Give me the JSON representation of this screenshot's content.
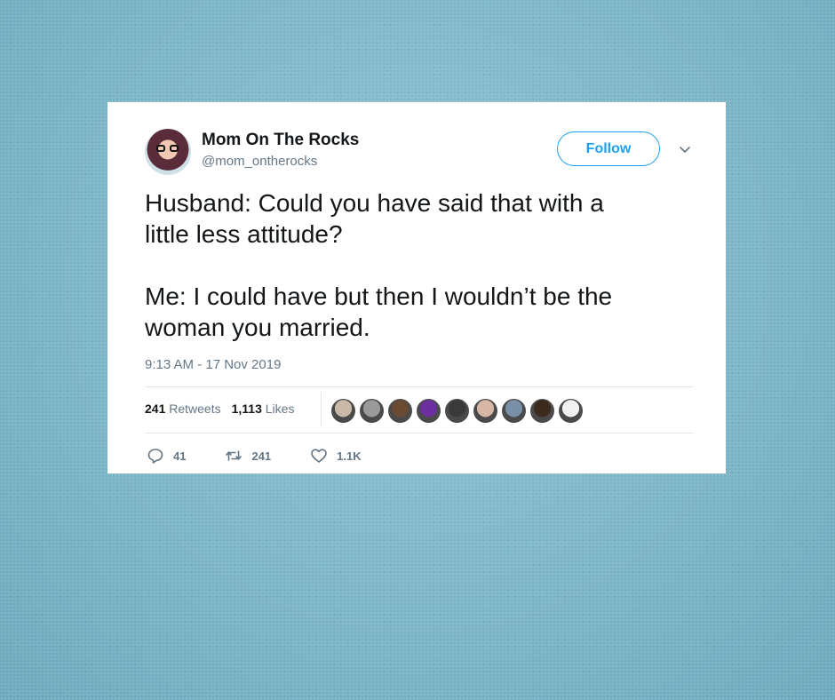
{
  "tweet": {
    "author_name": "Mom On The Rocks",
    "handle": "@mom_ontherocks",
    "follow_label": "Follow",
    "text": "Husband: Could you have said that with a\nlittle less attitude?\n\nMe: I could have but then I wouldn’t be the\nwoman you married.",
    "timestamp": "9:13 AM - 17 Nov 2019",
    "retweets_count": "241",
    "retweets_label": "Retweets",
    "likes_count": "1,113",
    "likes_label": "Likes",
    "reply_count": "41",
    "retweet_count_short": "241",
    "like_count_short": "1.1K",
    "liker_avatar_colors": [
      "#c9b9a8",
      "#9a9a9a",
      "#6b4a33",
      "#6c2fa0",
      "#3a3a3a",
      "#d7b6a6",
      "#7a8fa8",
      "#3d2a1e",
      "#f2f2f2"
    ]
  },
  "colors": {
    "background": "#82bacb",
    "accent": "#1da1f2",
    "text": "#14171a",
    "muted": "#657786"
  },
  "icons": [
    "chevron-down-icon",
    "reply-icon",
    "retweet-icon",
    "heart-icon"
  ]
}
